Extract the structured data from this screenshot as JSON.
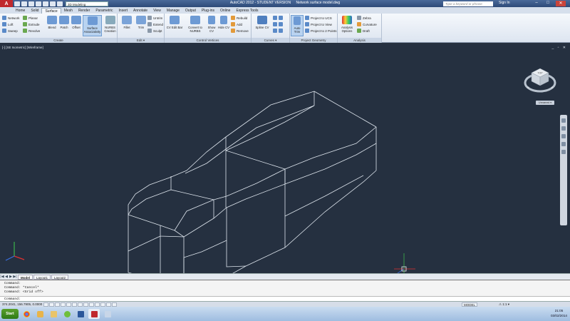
{
  "titlebar": {
    "app_logo": "A",
    "workspace": "3D Modeling",
    "app_title": "AutoCAD 2012 - STUDENT VERSION",
    "document": "Network surface model.dwg",
    "search_placeholder": "Type a keyword or phrase",
    "sign_in": "Sign In",
    "minimize": "–",
    "maximize": "□",
    "close": "✕"
  },
  "tabs": [
    "Home",
    "Solid",
    "Surface",
    "Mesh",
    "Render",
    "Parametric",
    "Insert",
    "Annotate",
    "View",
    "Manage",
    "Output",
    "Plug-ins",
    "Online",
    "Express Tools"
  ],
  "active_tab": "Surface",
  "ribbon": {
    "create": {
      "title": "Create",
      "network": "Network",
      "loft": "Loft",
      "sweep": "Sweep",
      "planar": "Planar",
      "extrude": "Extrude",
      "revolve": "Revolve",
      "blend": "Blend",
      "patch": "Patch",
      "offset": "Offset",
      "surface_associativity": "Surface Associativity",
      "nurbs_creation": "NURBS Creation"
    },
    "edit": {
      "title": "Edit ▾",
      "fillet": "Fillet",
      "trim": "Trim",
      "untrim": "Untrim",
      "extend": "Extend",
      "sculpt": "Sculpt"
    },
    "control_vertices": {
      "title": "Control Vertices",
      "cv_edit_bar": "CV Edit Bar",
      "convert_to_nurbs": "Convert to NURBS",
      "show_cv": "Show CV",
      "hide_cv": "Hide CV",
      "rebuild": "Rebuild",
      "add": "Add",
      "remove": "Remove"
    },
    "curves": {
      "title": "Curves ▾",
      "spline_cv": "Spline CV"
    },
    "project_geometry": {
      "title": "Project Geometry",
      "auto_trim": "Auto Trim",
      "project_to_ucs": "Project to UCS",
      "project_to_view": "Project to View",
      "project_to_2_points": "Project to 2 Points"
    },
    "analysis": {
      "title": "Analysis",
      "analysis_options": "Analysis Options",
      "zebra": "Zebra",
      "curvature": "Curvature",
      "draft": "Draft"
    }
  },
  "viewport": {
    "label": "[-] [SE Isometric] [Wireframe]",
    "controls": "_ ▫ ✕",
    "wcs": "Unnamed ▾",
    "viewcube_labels": {
      "face": "TOP",
      "n": "N",
      "s": "S",
      "e": "E",
      "w": "W"
    }
  },
  "layout_tabs": [
    "Model",
    "Layout1",
    "Layout2"
  ],
  "active_layout": "Model",
  "command_history": [
    "Command:",
    "Command: *Cancel*",
    "Command:  <Grid off>"
  ],
  "command_prompt": "Command:",
  "status": {
    "coords": "374.2041, 156.7905, 0.0000",
    "model": "MODEL",
    "scale": "⚠ 1:1 ▾"
  },
  "taskbar": {
    "start": "Start",
    "time": "21:05",
    "date": "03/02/2014"
  },
  "colors": {
    "viewport_bg": "#253040",
    "wireframe": "#dfe6ee",
    "ribbon_active": "#b9d3f0",
    "autocad_red": "#c0282d"
  }
}
